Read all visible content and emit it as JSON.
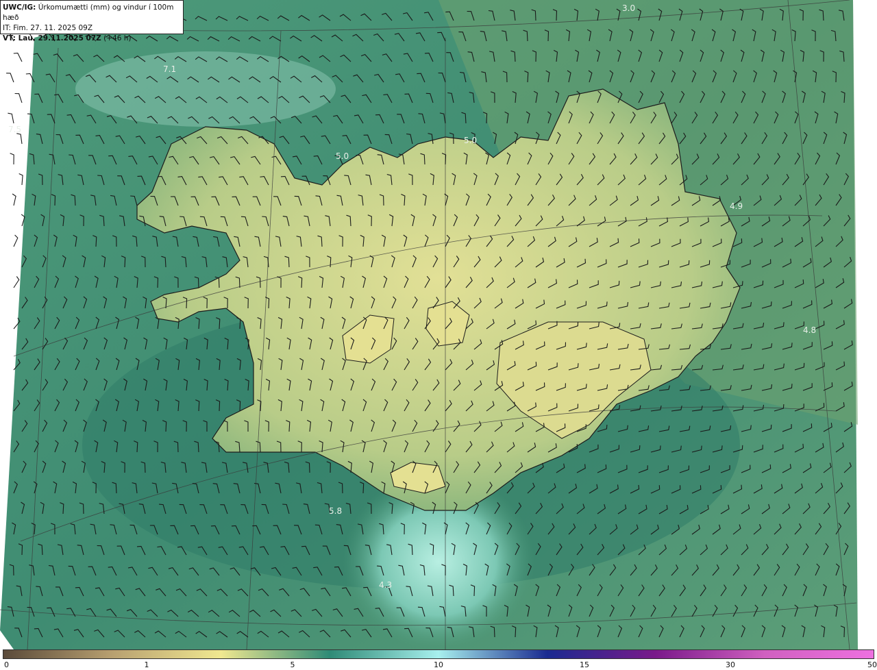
{
  "header": {
    "model": "UWC/IG:",
    "title": "Úrkomumætti (mm) og vindur í 100m hæð",
    "init_time": "IT: Fim. 27. 11. 2025 09Z",
    "valid_label": "VT: Lau. 29.11.2025 07Z",
    "valid_offset": "(+46 h)"
  },
  "map_labels": [
    "3.0",
    "7.1",
    "7.5",
    "5.0",
    "5.0",
    "4.9",
    "4.8",
    "5.8",
    "4.3"
  ],
  "colorbar": {
    "ticks": [
      "0",
      "1",
      "5",
      "10",
      "15",
      "30",
      "50"
    ],
    "colors": [
      "#5a4a3a",
      "#b8a070",
      "#f0e890",
      "#2e8a76",
      "#a8f0ee",
      "#1a2a90",
      "#7a1a8a",
      "#d060c0",
      "#ee70e0"
    ]
  },
  "colors": {
    "field_dark": "#2d7a66",
    "field_mid": "#6fa878",
    "field_light": "#dfe094",
    "field_cyan": "#a6e3d6",
    "land": "#d7d994",
    "line": "#1c1c1c"
  }
}
